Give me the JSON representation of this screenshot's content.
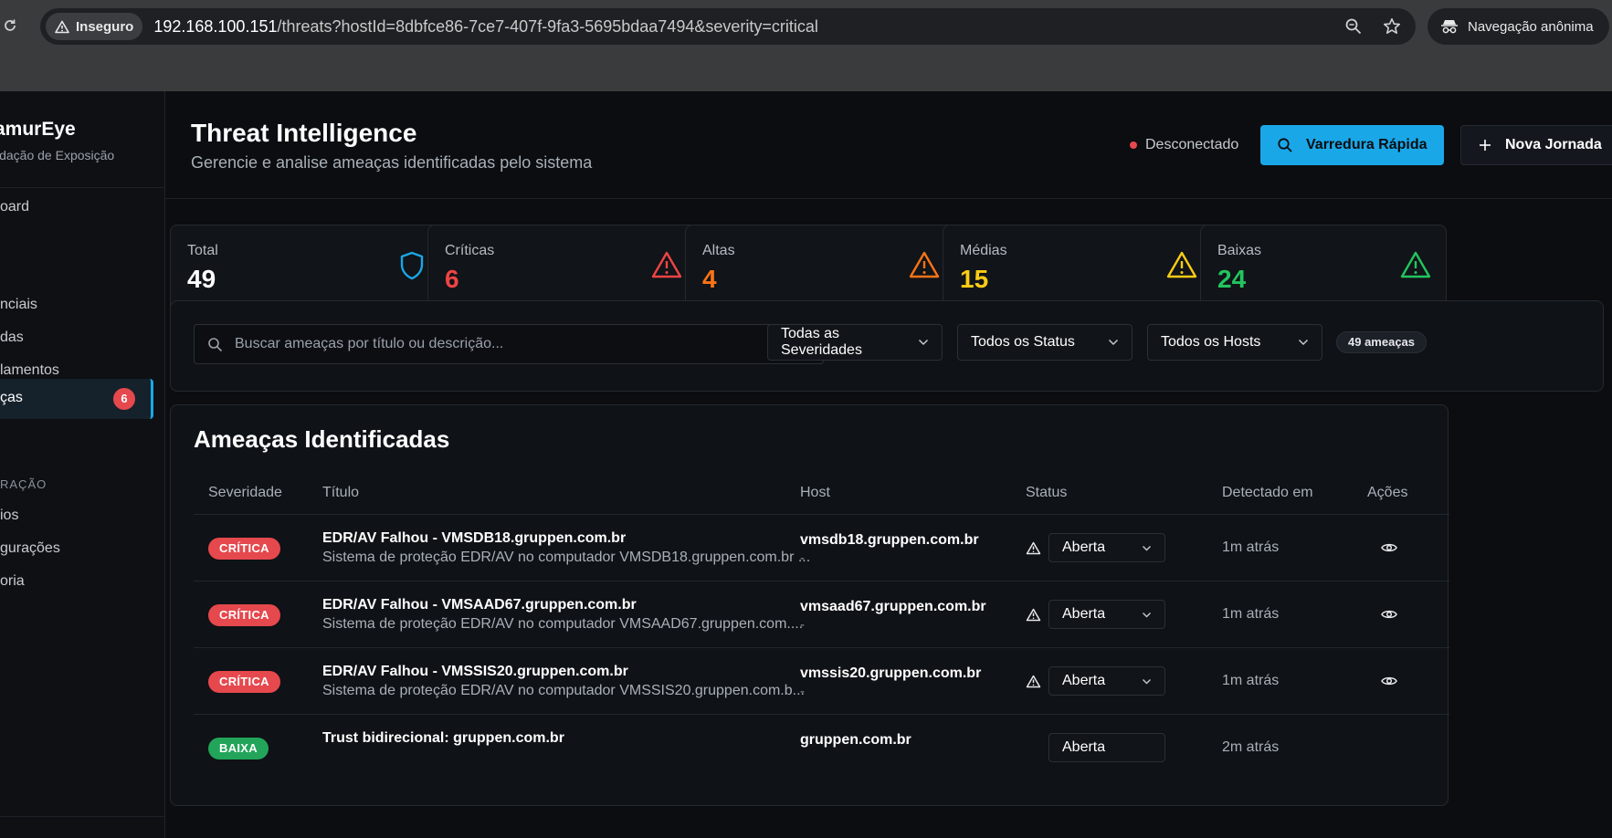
{
  "browser": {
    "insecure_label": "Inseguro",
    "url_host": "192.168.100.151",
    "url_path": "/threats?hostId=8dbfce86-7ce7-407f-9fa3-5695bdaa7494&severity=critical",
    "incognito_label": "Navegação anônima"
  },
  "sidebar": {
    "brand_name": "amurEye",
    "brand_sub": "idação de Exposição",
    "items": [
      {
        "label": "oard"
      },
      {
        "label": "nciais"
      },
      {
        "label": "das"
      },
      {
        "label": "lamentos"
      },
      {
        "label": "ças",
        "badge": "6",
        "active": true
      }
    ],
    "section_label": "RAÇÃO",
    "section_items": [
      {
        "label": "ios"
      },
      {
        "label": "gurações"
      },
      {
        "label": "oria"
      }
    ]
  },
  "header": {
    "title": "Threat Intelligence",
    "subtitle": "Gerencie e analise ameaças identificadas pelo sistema",
    "connection_status": "Desconectado",
    "quick_scan_label": "Varredura Rápida",
    "new_journey_label": "Nova Jornada"
  },
  "stats": [
    {
      "label": "Total",
      "value": "49",
      "color": "#ffffff",
      "icon": "shield-icon",
      "icon_color": "#1aa7e8"
    },
    {
      "label": "Críticas",
      "value": "6",
      "color": "#ef4444",
      "icon": "alert-triangle-icon",
      "icon_color": "#ef4444"
    },
    {
      "label": "Altas",
      "value": "4",
      "color": "#f97316",
      "icon": "alert-triangle-icon",
      "icon_color": "#f97316"
    },
    {
      "label": "Médias",
      "value": "15",
      "color": "#facc15",
      "icon": "alert-triangle-icon",
      "icon_color": "#facc15"
    },
    {
      "label": "Baixas",
      "value": "24",
      "color": "#22c55e",
      "icon": "alert-triangle-icon",
      "icon_color": "#22c55e"
    }
  ],
  "filters": {
    "search_placeholder": "Buscar ameaças por título ou descrição...",
    "severity": "Todas as Severidades",
    "status": "Todos os Status",
    "hosts": "Todos os Hosts",
    "count": "49 ameaças"
  },
  "table": {
    "title": "Ameaças Identificadas",
    "columns": [
      "Severidade",
      "Título",
      "Host",
      "Status",
      "Detectado em",
      "Ações"
    ],
    "rows": [
      {
        "severity": "CRÍTICA",
        "sev_color": "#e5484d",
        "title": "EDR/AV Falhou - VMSDB18.gruppen.com.br",
        "desc": "Sistema de proteção EDR/AV no computador VMSDB18.gruppen.com.br ...",
        "host": "vmsdb18.gruppen.com.br",
        "host_sub": "-",
        "status": "Aberta",
        "detected": "1m atrás"
      },
      {
        "severity": "CRÍTICA",
        "sev_color": "#e5484d",
        "title": "EDR/AV Falhou - VMSAAD67.gruppen.com.br",
        "desc": "Sistema de proteção EDR/AV no computador VMSAAD67.gruppen.com....",
        "host": "vmsaad67.gruppen.com.br",
        "host_sub": "-",
        "status": "Aberta",
        "detected": "1m atrás"
      },
      {
        "severity": "CRÍTICA",
        "sev_color": "#e5484d",
        "title": "EDR/AV Falhou - VMSSIS20.gruppen.com.br",
        "desc": "Sistema de proteção EDR/AV no computador VMSSIS20.gruppen.com.b...",
        "host": "vmssis20.gruppen.com.br",
        "host_sub": "-",
        "status": "Aberta",
        "detected": "1m atrás"
      },
      {
        "severity": "BAIXA",
        "sev_color": "#22a55a",
        "title": "Trust bidirecional: gruppen.com.br",
        "desc": "",
        "host": "gruppen.com.br",
        "host_sub": "",
        "status": "Aberta",
        "detected": "2m atrás"
      }
    ]
  }
}
